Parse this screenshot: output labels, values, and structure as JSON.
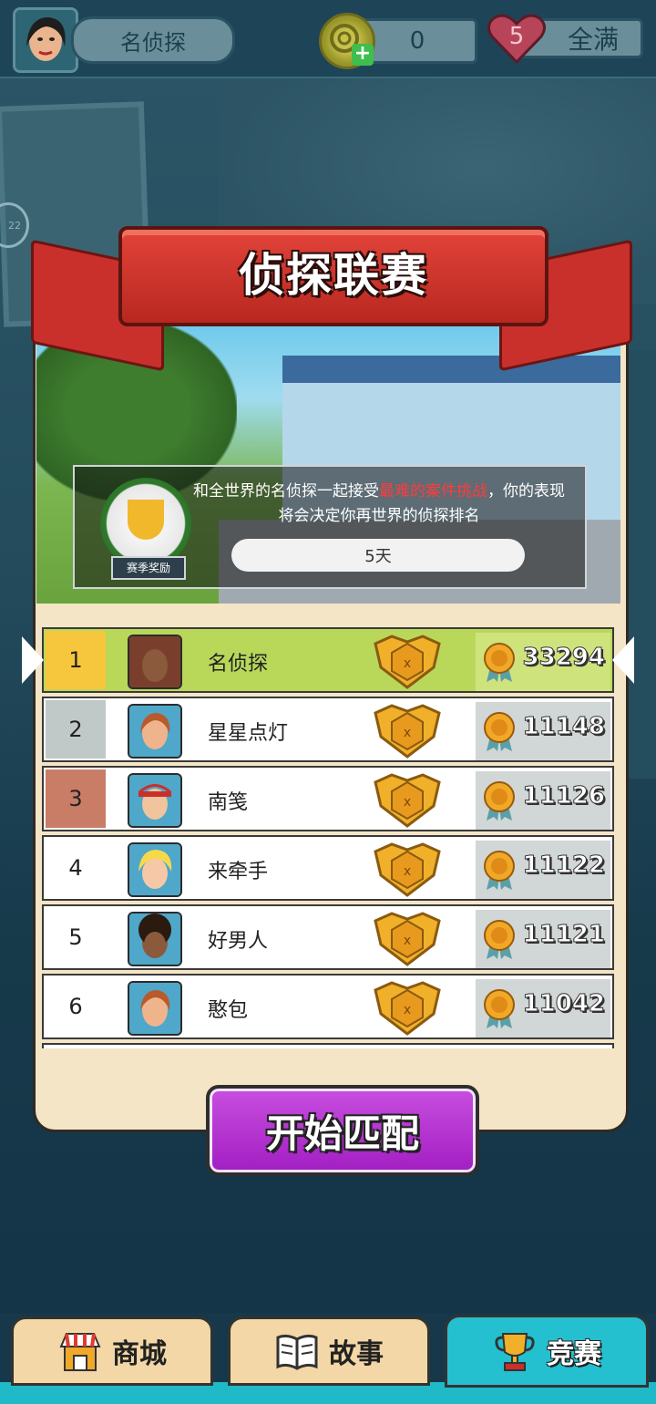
{
  "header": {
    "player_name": "名侦探",
    "coins": "0",
    "lives": "5",
    "lives_status": "全满"
  },
  "side_badge": "22",
  "league": {
    "title": "侦探联赛",
    "description_before": "和全世界的名侦探一起接受",
    "description_highlight": "最难的案件挑战",
    "description_after": "，你的表现将会决定你再世界的侦探排名",
    "reward_label": "赛季奖励",
    "remaining": "5天"
  },
  "leaderboard": [
    {
      "rank": "1",
      "name": "名侦探",
      "score": "33294"
    },
    {
      "rank": "2",
      "name": "星星点灯",
      "score": "11148"
    },
    {
      "rank": "3",
      "name": "南笺",
      "score": "11126"
    },
    {
      "rank": "4",
      "name": "来牵手",
      "score": "11122"
    },
    {
      "rank": "5",
      "name": "好男人",
      "score": "11121"
    },
    {
      "rank": "6",
      "name": "憨包",
      "score": "11042"
    }
  ],
  "start_button": "开始匹配",
  "tabs": [
    {
      "label": "商城",
      "icon": "shop-icon"
    },
    {
      "label": "故事",
      "icon": "book-icon"
    },
    {
      "label": "竞赛",
      "icon": "trophy-icon"
    }
  ],
  "colors": {
    "accent_purple": "#a21ec2",
    "banner_red": "#c9302c",
    "active_tab": "#24c0d0",
    "highlight_text": "#ff3b3b"
  }
}
